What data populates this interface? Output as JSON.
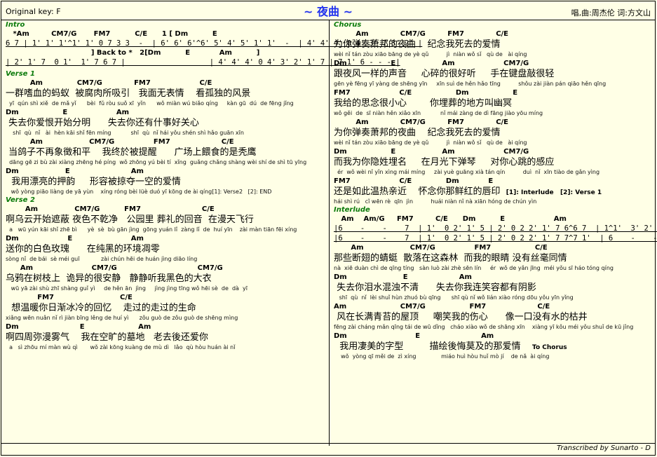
{
  "header": {
    "original_key": "Original key: F",
    "title": "~ 夜曲 ~",
    "credits": "唱,曲:周杰伦  词:方文山"
  },
  "footer": {
    "transcriber": "Transcribed by Sunarto - D"
  },
  "left": [
    {
      "t": "sec",
      "v": "Intro"
    },
    {
      "t": "chord",
      "v": "   *Am         CM7/G       FM7          C/E      1 [ Dm          E"
    },
    {
      "t": "num",
      "v": "6 7 | 1' 1' 1'^1' 1' 0 7 3 3  -  | 6' 6' 6'^6' 5' 4' 5' 1' 1'  -  | 4' 4' 4' 0 4' 3' 7 3' 2' |"
    },
    {
      "t": "chord",
      "v": "                                   ] Back to *   2[Dm          E            Am          ]"
    },
    {
      "t": "num",
      "v": "| 2' 1' 7  0 1'  1' 7 6 7 |                   | 4' 4' 4' 0 4' 3' 2' 1' 7 | 7 1' 6 - - - |"
    },
    {
      "t": "gap"
    },
    {
      "t": "sec",
      "v": "Verse 1"
    },
    {
      "t": "chord",
      "v": "          Am              CM7/G             FM7                    C/E"
    },
    {
      "t": "lyric",
      "v": "一群嗜血的蚂蚁  被腐肉所吸引   我面无表情    看孤独的风景"
    },
    {
      "t": "pin",
      "v": "  yī  qún shì xiě  de mǎ yǐ      bèi  fǔ ròu suǒ xī  yǐn      wǒ miàn wú biǎo qíng     kàn gū  dú  de fēng jǐng"
    },
    {
      "t": "chord",
      "v": "Dm                  E                    Am"
    },
    {
      "t": "lyric",
      "v": " 失去你爱恨开始分明      失去你还有什事好关心"
    },
    {
      "t": "pin",
      "v": "    shī  qù  nǐ   ài  hèn kāi shǐ fēn míng           shī  qù  nǐ hái yǒu shén shì hǎo guān xīn"
    },
    {
      "t": "chord",
      "v": "          Am                   CM7/G                FM7                     C/E"
    },
    {
      "t": "lyric",
      "v": " 当鸽子不再象徵和平    我终於被提醒      广场上餵食的是秃鹰"
    },
    {
      "t": "pin",
      "v": "  dāng gē zi bù zài xiàng zhēng hé píng  wǒ zhōng yú bèi tí  xǐng  guǎng chǎng shàng wèi shí de shì tū yīng"
    },
    {
      "t": "chord",
      "v": "Dm                   E                         Am"
    },
    {
      "t": "lyric",
      "v": "  我用漂亮的押韵     形容被掠夺一空的爱情  "
    },
    {
      "t": "pin",
      "v": "   wǒ yòng piāo liàng de yā yùn    xíng róng bèi lüè duó yī kōng de ài qíng"
    },
    {
      "t": "sec",
      "v": "Verse 2"
    },
    {
      "t": "chord",
      "v": "        Am               CM7/G          FM7                         C/E"
    },
    {
      "t": "lyric",
      "v": "啊乌云开始遮蔽 夜色不乾净   公园里 葬礼的回音  在漫天飞行"
    },
    {
      "t": "pin",
      "v": "  a   wū yún kāi shǐ zhē bì      yè  sè  bù gān jìng  gōng yuán lǐ  zàng lǐ  de  huí yīn    zài màn tiān fēi xíng"
    },
    {
      "t": "chord",
      "v": "Dm                    E                        Am"
    },
    {
      "t": "lyric",
      "v": "送你的白色玫瑰      在纯黑的环境凋零"
    },
    {
      "t": "pin",
      "v": "sòng nǐ  de bái  sè méi guī            zài chún hēi de huán jìng diāo líng"
    },
    {
      "t": "chord",
      "v": "      Am                        CM7/G                                 CM7/G"
    },
    {
      "t": "lyric",
      "v": "乌鸦在树枝上  诡异的很安静   静静听我黑色的大衣"
    },
    {
      "t": "pin",
      "v": "   wū yā zài shù zhī shàng guǐ yì     de hěn ān  jìng     jìng jìng tīng wǒ hēi sè  de  dà  yī"
    },
    {
      "t": "chord",
      "v": "             FM7                           C/E"
    },
    {
      "t": "lyric",
      "v": "  想温暖你日渐冰冷的回忆    走过的走过的生命"
    },
    {
      "t": "pin",
      "v": "xiǎng wēn nuǎn nǐ rì jiàn bīng lěng de huí yì      zǒu guò de zǒu guò de shēng mìng"
    },
    {
      "t": "chord",
      "v": "Dm                         E                      Am"
    },
    {
      "t": "lyric",
      "v": "啊四周弥漫雾气    我在空旷的墓地   老去後还爱你"
    },
    {
      "t": "pin",
      "v": "  a   sì zhōu mí màn wù qì       wǒ zài kōng kuàng de mù dì   lǎo  qù hòu huán ài nǐ"
    }
  ],
  "right": [
    {
      "t": "sec",
      "v": "Chorus"
    },
    {
      "t": "chord",
      "v": "         Am             CM7/G         FM7             C/E"
    },
    {
      "t": "lyric",
      "v": "为你弹奏萧邦的夜曲    纪念我死去的爱情"
    },
    {
      "t": "pin",
      "v": "wèi nǐ tán zòu xiāo bāng de yè qǔ          jì  niàn wǒ sǐ   qù de   ài qíng"
    },
    {
      "t": "chord",
      "v": "Dm                  E                   Am                    CM7/G"
    },
    {
      "t": "lyric",
      "v": "跟夜风一样的声音     心碎的很好听     手在键盘敲很轻"
    },
    {
      "t": "pin",
      "v": "gēn yè fēng yī yàng de shēng yīn     xīn suì de hěn hǎo tīng          shǒu zài jiàn pán qiāo hěn qīng"
    },
    {
      "t": "chord",
      "v": "FM7                    C/E                  Dm                  E"
    },
    {
      "t": "lyric",
      "v": "我给的思念很小心        你埋葬的地方叫幽冥"
    },
    {
      "t": "pin",
      "v": "wǒ gěi  de  sī niàn hěn xiǎo xīn           nǐ mái zàng de dì fāng jiào yōu míng"
    },
    {
      "t": "chord",
      "v": "         Am             CM7/G         FM7             C/E"
    },
    {
      "t": "lyric",
      "v": "为你弹奏萧邦的夜曲    纪念我死去的爱情"
    },
    {
      "t": "pin",
      "v": "wèi nǐ tán zòu xiāo bāng de yè qǔ          jì  niàn wǒ sǐ   qù de   ài qíng"
    },
    {
      "t": "chord",
      "v": "Dm                  E                   Am                    CM7/G"
    },
    {
      "t": "lyric",
      "v": "而我为你隐姓埋名     在月光下弹琴     对你心跳的感应"
    },
    {
      "t": "pin",
      "v": "  ér  wǒ wèi nǐ yǐn xìng mái míng     zài yuè guāng xià tán qín          duì  nǐ  xīn tiào de gǎn yìng"
    },
    {
      "t": "chord",
      "v": "FM7                    C/E              Dm            E"
    },
    {
      "t": "lyric",
      "v": "还是如此温热亲近    怀念你那鲜红的唇印  "
    },
    {
      "t": "pin",
      "v": "hái shì rú   cǐ wēn rè  qīn  jìn          huái niàn nǐ nà xiān hóng de chún yìn"
    },
    {
      "t": "sec",
      "v": "Interlude"
    },
    {
      "t": "chord",
      "v": "   Am    Am/G     FM7         C/E      Dm          E                    Am"
    },
    {
      "t": "num",
      "v": "|6    -    -    7  | 1'  0 2' 1' 5 | 2' 0 2 2' 1' 7 6^6 7  | 1^1'  3' 2' 3|"
    },
    {
      "t": "num",
      "v": "|6    -    -    7  | 1'  0 2' 1' 5 | 2' 0 2 2' 1' 7 7^7 1'  | 6    -    -    - |"
    },
    {
      "t": "chord",
      "v": "       Am                   CM7/G                FM7                  C/E"
    },
    {
      "t": "lyric",
      "v": "那些断翅的蜻蜓  散落在这森林  而我的眼睛 没有丝毫同情"
    },
    {
      "t": "pin",
      "v": "nà  xiē duàn chì de qīng tíng   sàn luò zài zhè sēn lín     ér  wǒ de yǎn jīng  méi yǒu sī háo tóng qíng"
    },
    {
      "t": "chord",
      "v": "Dm                       E                     Am"
    },
    {
      "t": "lyric",
      "v": " 失去你泪水混浊不清      失去你我连笑容都有阴影"
    },
    {
      "t": "pin",
      "v": "   shī  qù  nǐ  lèi shuǐ hùn zhuó bù qīng      shī qù nǐ wǒ lián xiào róng dōu yǒu yīn yǐng"
    },
    {
      "t": "chord",
      "v": "Am                      CM7/G                  FM7                     C/E"
    },
    {
      "t": "lyric",
      "v": " 风在长满青苔的屋顶     嘲笑我的伤心      像一口没有水的枯井"
    },
    {
      "t": "pin",
      "v": "fēng zài cháng mǎn qīng tái de wū dǐng   cháo xiào wǒ de shāng xīn    xiàng yī kǒu méi yǒu shuǐ de kū jǐng"
    },
    {
      "t": "chord",
      "v": "Dm                            E                         Am"
    },
    {
      "t": "lyric",
      "v": "  我用凄美的字型         描绘後悔莫及的那爱情    "
    },
    {
      "t": "pin",
      "v": "    wǒ  yòng qī měi de  zì xíng              miáo huì hòu huǐ mò jí    de nǎ  ài qíng"
    }
  ],
  "tags": {
    "verse1_end": "[1]: Verse2   [2]: END",
    "chorus_end": "[1]: Interlude   [2]: Verse 1",
    "to_chorus": "To Chorus"
  }
}
